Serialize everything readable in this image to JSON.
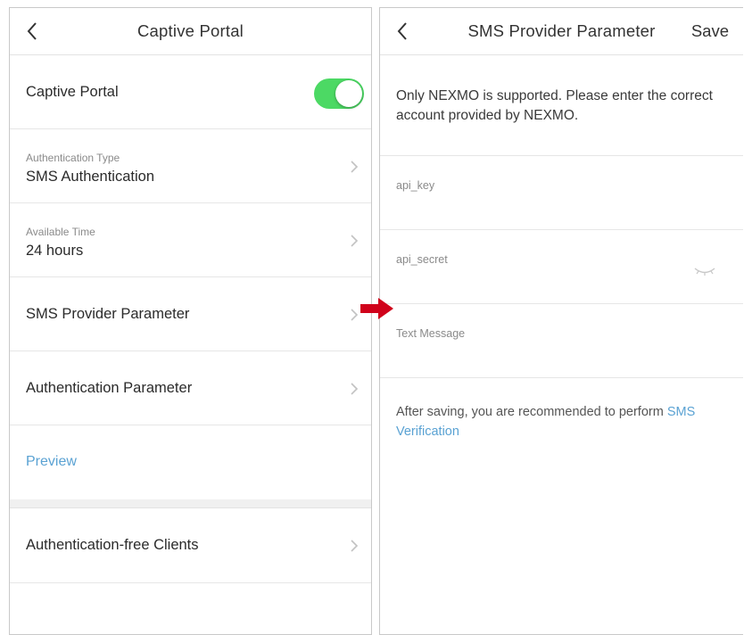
{
  "left_screen": {
    "title": "Captive Portal",
    "captive_portal": {
      "label": "Captive Portal",
      "enabled": true,
      "toggle_color": "#4cd964"
    },
    "auth_type": {
      "sublabel": "Authentication Type",
      "value": "SMS Authentication"
    },
    "available_time": {
      "sublabel": "Available Time",
      "value": "24 hours"
    },
    "sms_provider": {
      "label": "SMS Provider Parameter"
    },
    "auth_parameter": {
      "label": "Authentication Parameter"
    },
    "preview": {
      "label": "Preview",
      "color": "#5aa2d3"
    },
    "auth_free_clients": {
      "label": "Authentication-free Clients"
    }
  },
  "right_screen": {
    "title": "SMS Provider Parameter",
    "save_label": "Save",
    "info_text": "Only NEXMO is supported. Please enter the correct account provided by NEXMO.",
    "fields": {
      "api_key": {
        "label": "api_key",
        "value": ""
      },
      "api_secret": {
        "label": "api_secret",
        "value": ""
      },
      "text_message": {
        "label": "Text Message",
        "value": ""
      }
    },
    "note_text": "After saving, you are recommended to perform ",
    "note_link": "SMS Verification"
  },
  "annotation": {
    "arrow_color": "#d0021b"
  }
}
